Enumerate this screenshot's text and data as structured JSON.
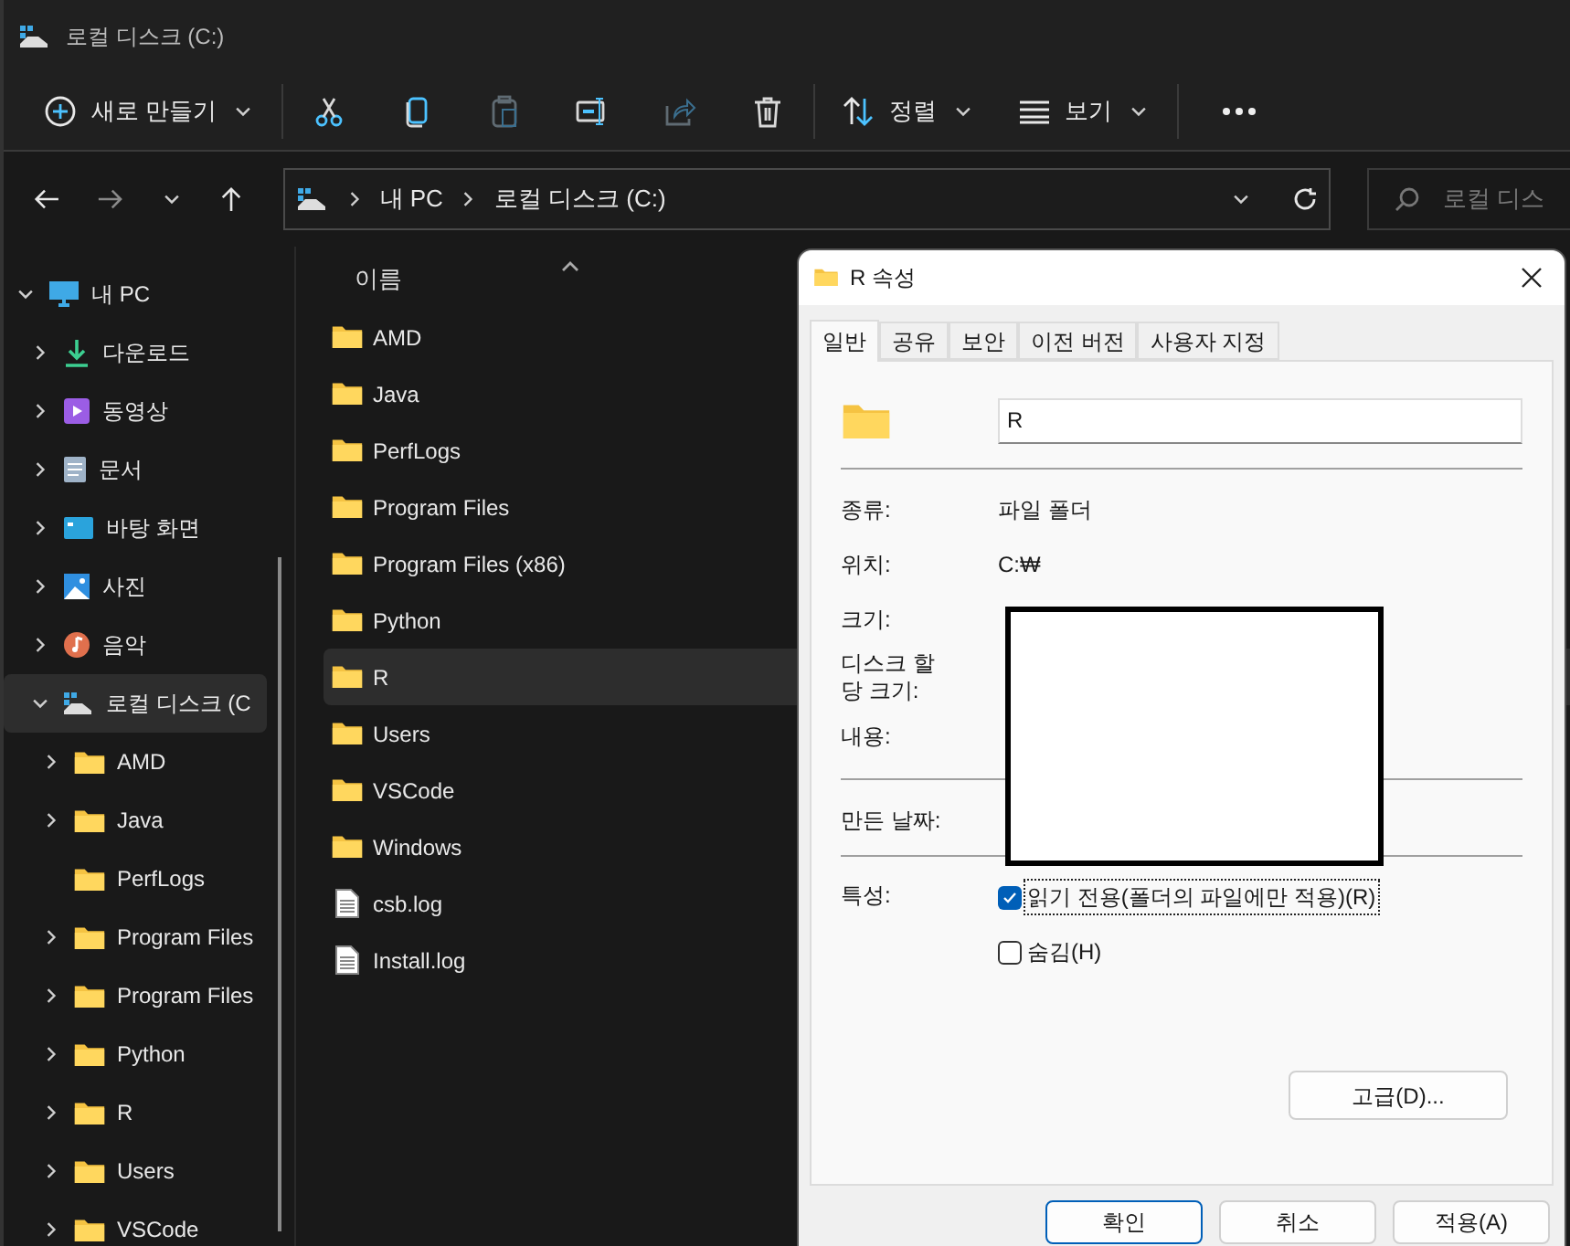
{
  "window": {
    "title": "로컬 디스크 (C:)"
  },
  "toolbar": {
    "new_button": "새로 만들기",
    "actions": [
      {
        "kind": "cut",
        "disabled": false
      },
      {
        "kind": "copy",
        "disabled": false
      },
      {
        "kind": "paste",
        "disabled": true
      },
      {
        "kind": "rename",
        "disabled": false
      },
      {
        "kind": "share",
        "disabled": true
      },
      {
        "kind": "delete",
        "disabled": false
      }
    ],
    "sort": "정렬",
    "view": "보기"
  },
  "address": {
    "path": [
      "내 PC",
      "로컬 디스크 (C:)"
    ]
  },
  "search": {
    "placeholder": "로컬 디스"
  },
  "sidebar": {
    "items": [
      {
        "label": "내 PC",
        "kind": "pc",
        "expandable": true,
        "expanded": true,
        "selected": false,
        "children": [
          {
            "label": "다운로드",
            "kind": "download",
            "expandable": true,
            "expanded": false,
            "selected": false
          },
          {
            "label": "동영상",
            "kind": "video",
            "expandable": true,
            "expanded": false,
            "selected": false
          },
          {
            "label": "문서",
            "kind": "documents",
            "expandable": true,
            "expanded": false,
            "selected": false
          },
          {
            "label": "바탕 화면",
            "kind": "desktop",
            "expandable": true,
            "expanded": false,
            "selected": false
          },
          {
            "label": "사진",
            "kind": "pictures",
            "expandable": true,
            "expanded": false,
            "selected": false
          },
          {
            "label": "음악",
            "kind": "music",
            "expandable": true,
            "expanded": false,
            "selected": false
          },
          {
            "label": "로컬 디스크 (C",
            "kind": "drive",
            "expandable": true,
            "expanded": true,
            "selected": true,
            "children": [
              {
                "label": "AMD",
                "kind": "folder",
                "expandable": true,
                "expanded": false,
                "selected": false
              },
              {
                "label": "Java",
                "kind": "folder",
                "expandable": true,
                "expanded": false,
                "selected": false
              },
              {
                "label": "PerfLogs",
                "kind": "folder",
                "expandable": false,
                "expanded": false,
                "selected": false
              },
              {
                "label": "Program Files",
                "kind": "folder",
                "expandable": true,
                "expanded": false,
                "selected": false
              },
              {
                "label": "Program Files",
                "kind": "folder",
                "expandable": true,
                "expanded": false,
                "selected": false
              },
              {
                "label": "Python",
                "kind": "folder",
                "expandable": true,
                "expanded": false,
                "selected": false
              },
              {
                "label": "R",
                "kind": "folder",
                "expandable": true,
                "expanded": false,
                "selected": false
              },
              {
                "label": "Users",
                "kind": "folder",
                "expandable": true,
                "expanded": false,
                "selected": false
              },
              {
                "label": "VSCode",
                "kind": "folder",
                "expandable": true,
                "expanded": false,
                "selected": false
              }
            ]
          }
        ]
      }
    ]
  },
  "file_list": {
    "column": "이름",
    "items": [
      {
        "name": "AMD",
        "kind": "folder",
        "selected": false
      },
      {
        "name": "Java",
        "kind": "folder",
        "selected": false
      },
      {
        "name": "PerfLogs",
        "kind": "folder",
        "selected": false
      },
      {
        "name": "Program Files",
        "kind": "folder",
        "selected": false
      },
      {
        "name": "Program Files (x86)",
        "kind": "folder",
        "selected": false
      },
      {
        "name": "Python",
        "kind": "folder",
        "selected": false
      },
      {
        "name": "R",
        "kind": "folder",
        "selected": true
      },
      {
        "name": "Users",
        "kind": "folder",
        "selected": false
      },
      {
        "name": "VSCode",
        "kind": "folder",
        "selected": false
      },
      {
        "name": "Windows",
        "kind": "folder",
        "selected": false
      },
      {
        "name": "csb.log",
        "kind": "file",
        "selected": false
      },
      {
        "name": "Install.log",
        "kind": "file",
        "selected": false
      }
    ]
  },
  "dialog": {
    "title": "R 속성",
    "tabs": [
      {
        "label": "일반",
        "selected": true
      },
      {
        "label": "공유",
        "selected": false
      },
      {
        "label": "보안",
        "selected": false
      },
      {
        "label": "이전 버전",
        "selected": false
      },
      {
        "label": "사용자 지정",
        "selected": false
      }
    ],
    "name_value": "R",
    "property_groups": [
      [
        {
          "label": "종류:",
          "value": "파일 폴더"
        },
        {
          "label": "위치:",
          "value": "C:₩"
        },
        {
          "label": "크기:"
        },
        {
          "label": "디스크 할당 크기:"
        },
        {
          "label": "내용:"
        }
      ],
      [
        {
          "label": "만든 날짜:"
        }
      ]
    ],
    "attributes_label": "특성:",
    "attributes": [
      {
        "label": "읽기 전용(폴더의 파일에만 적용)(R)",
        "checked": true,
        "focused": true
      },
      {
        "label": "숨김(H)",
        "checked": false,
        "focused": false
      }
    ],
    "advanced_button": "고급(D)...",
    "redacted": true,
    "buttons": [
      {
        "label": "확인",
        "default": true
      },
      {
        "label": "취소",
        "default": false
      },
      {
        "label": "적용(A)",
        "default": false
      }
    ]
  }
}
